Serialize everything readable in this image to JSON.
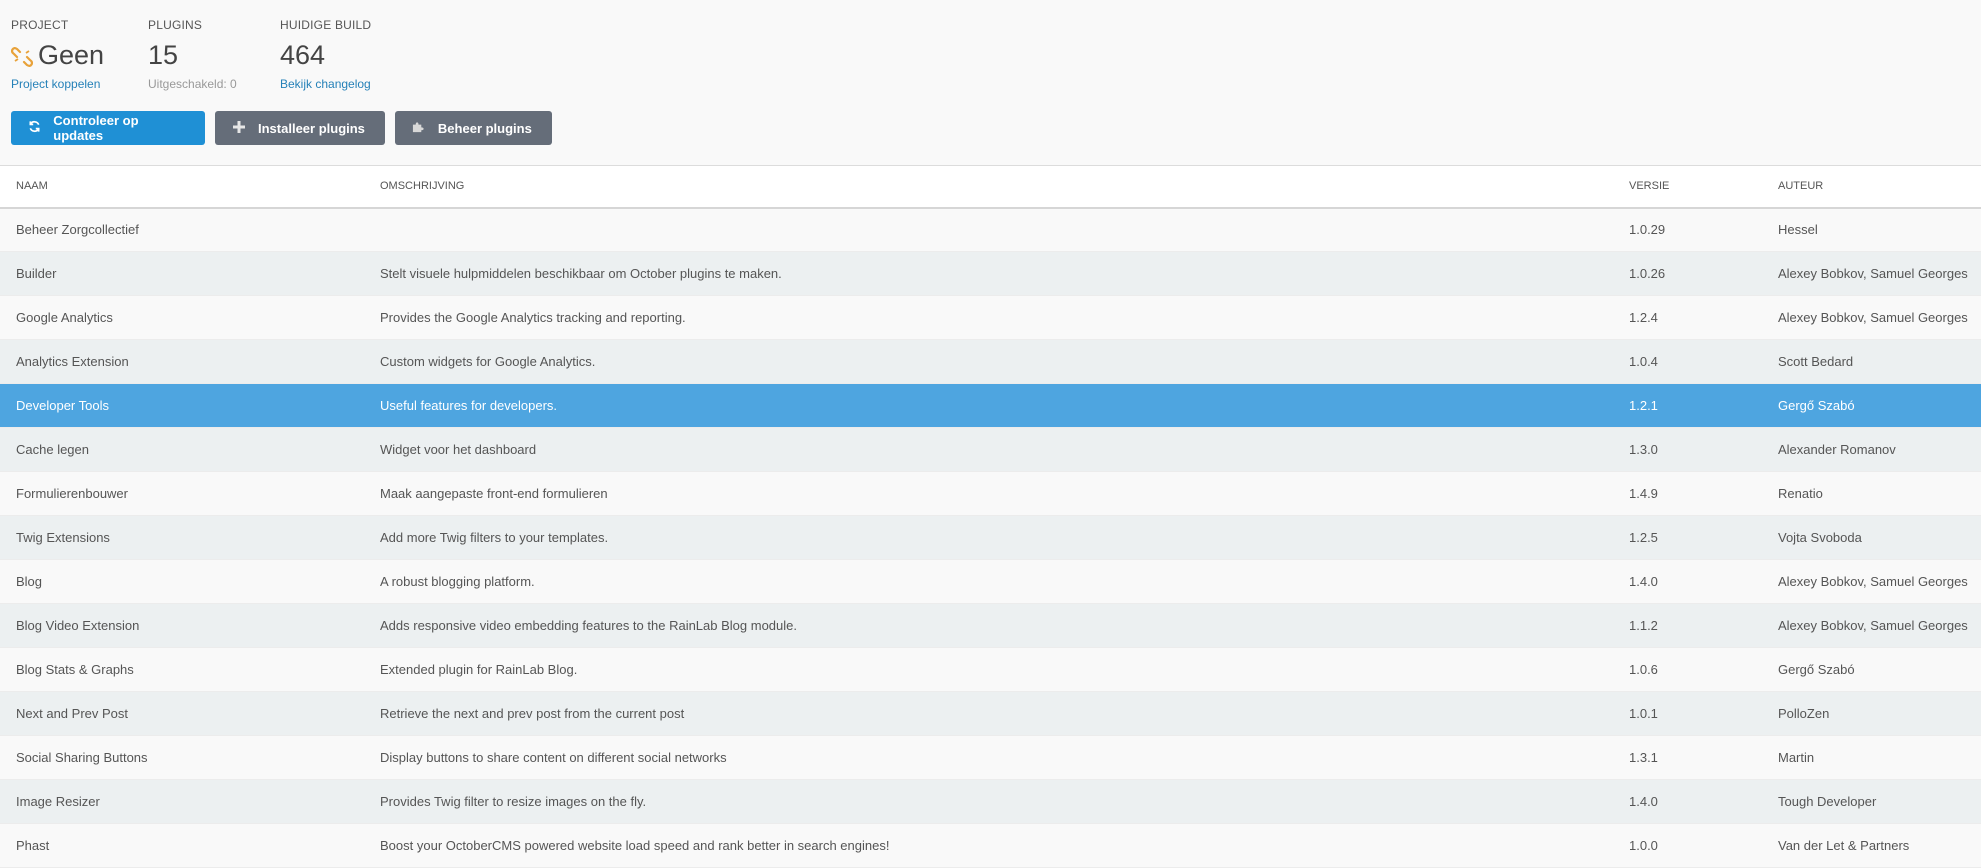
{
  "scoreboard": {
    "project": {
      "label": "PROJECT",
      "value": "Geen",
      "link": "Project koppelen"
    },
    "plugins": {
      "label": "PLUGINS",
      "value": "15",
      "sub": "Uitgeschakeld: 0"
    },
    "build": {
      "label": "HUIDIGE BUILD",
      "value": "464",
      "link": "Bekijk changelog"
    }
  },
  "toolbar": {
    "check_updates": "Controleer op updates",
    "install_plugins": "Installeer plugins",
    "manage_plugins": "Beheer plugins"
  },
  "icons": {
    "project": "unlink-icon",
    "check_updates": "refresh-icon",
    "install_plugins": "plus-icon",
    "manage_plugins": "puzzle-icon"
  },
  "colors": {
    "primary": "#1f90d5",
    "default_button": "#656d79",
    "active_row": "#4ea5e0",
    "link": "#2581b8",
    "project_icon": "#e8a23a"
  },
  "table": {
    "headers": {
      "name": "NAAM",
      "description": "OMSCHRIJVING",
      "version": "VERSIE",
      "author": "AUTEUR"
    },
    "rows": [
      {
        "name": "Beheer Zorgcollectief",
        "description": "",
        "version": "1.0.29",
        "author": "Hessel"
      },
      {
        "name": "Builder",
        "description": "Stelt visuele hulpmiddelen beschikbaar om October plugins te maken.",
        "version": "1.0.26",
        "author": "Alexey Bobkov, Samuel Georges"
      },
      {
        "name": "Google Analytics",
        "description": "Provides the Google Analytics tracking and reporting.",
        "version": "1.2.4",
        "author": "Alexey Bobkov, Samuel Georges"
      },
      {
        "name": "Analytics Extension",
        "description": "Custom widgets for Google Analytics.",
        "version": "1.0.4",
        "author": "Scott Bedard"
      },
      {
        "name": "Developer Tools",
        "description": "Useful features for developers.",
        "version": "1.2.1",
        "author": "Gergő Szabó"
      },
      {
        "name": "Cache legen",
        "description": "Widget voor het dashboard",
        "version": "1.3.0",
        "author": "Alexander Romanov"
      },
      {
        "name": "Formulierenbouwer",
        "description": "Maak aangepaste front-end formulieren",
        "version": "1.4.9",
        "author": "Renatio"
      },
      {
        "name": "Twig Extensions",
        "description": "Add more Twig filters to your templates.",
        "version": "1.2.5",
        "author": "Vojta Svoboda"
      },
      {
        "name": "Blog",
        "description": "A robust blogging platform.",
        "version": "1.4.0",
        "author": "Alexey Bobkov, Samuel Georges"
      },
      {
        "name": "Blog Video Extension",
        "description": "Adds responsive video embedding features to the RainLab Blog module.",
        "version": "1.1.2",
        "author": "Alexey Bobkov, Samuel Georges"
      },
      {
        "name": "Blog Stats & Graphs",
        "description": "Extended plugin for RainLab Blog.",
        "version": "1.0.6",
        "author": "Gergő Szabó"
      },
      {
        "name": "Next and Prev Post",
        "description": "Retrieve the next and prev post from the current post",
        "version": "1.0.1",
        "author": "PolloZen"
      },
      {
        "name": "Social Sharing Buttons",
        "description": "Display buttons to share content on different social networks",
        "version": "1.3.1",
        "author": "Martin"
      },
      {
        "name": "Image Resizer",
        "description": "Provides Twig filter to resize images on the fly.",
        "version": "1.4.0",
        "author": "Tough Developer"
      },
      {
        "name": "Phast",
        "description": "Boost your OctoberCMS powered website load speed and rank better in search engines!",
        "version": "1.0.0",
        "author": "Van der Let & Partners"
      }
    ]
  }
}
